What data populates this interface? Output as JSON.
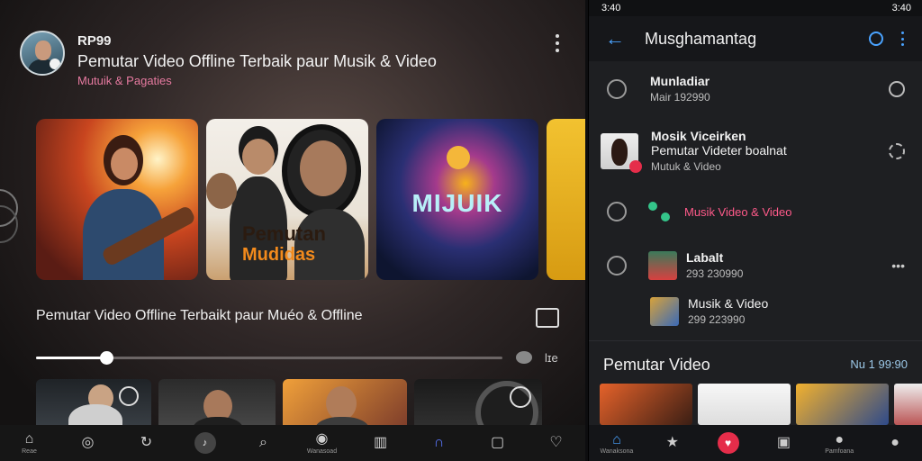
{
  "left": {
    "profile": {
      "username": "RP99",
      "title": "Pemutar Video Offline Terbaik paur Musik & Video",
      "subtitle": "Mutuik & Pagaties"
    },
    "cards": [
      {
        "text": ""
      },
      {
        "text_line1": "Pemutan",
        "text_line2": "Mudidas"
      },
      {
        "text": "MIJUIK"
      },
      {
        "text": ""
      }
    ],
    "now_playing": {
      "title": "Pemutar Video Offline Terbaikt paur Muéo & Offline",
      "progress": 0.15,
      "duration": "lɪe"
    },
    "bottom_nav": [
      {
        "icon": "home-icon",
        "glyph": "⌂",
        "label": "Reae"
      },
      {
        "icon": "headphones-icon",
        "glyph": "◎",
        "label": ""
      },
      {
        "icon": "refresh-icon",
        "glyph": "↻",
        "label": ""
      },
      {
        "icon": "music-icon",
        "glyph": "♪",
        "label": ""
      },
      {
        "icon": "search-icon",
        "glyph": "⌕",
        "label": ""
      },
      {
        "icon": "compass-icon",
        "glyph": "◉",
        "label": "Wanasoad"
      },
      {
        "icon": "library-icon",
        "glyph": "▥",
        "label": ""
      },
      {
        "icon": "headset-icon",
        "glyph": "∩",
        "label": ""
      },
      {
        "icon": "square-icon",
        "glyph": "▢",
        "label": ""
      },
      {
        "icon": "heart-icon",
        "glyph": "♡",
        "label": ""
      }
    ]
  },
  "right": {
    "status_time": "3:40",
    "status_right": "3:40",
    "appbar_title": "Musghamantag",
    "rows": [
      {
        "title": "Munladiar",
        "sub": "Mair 192990"
      },
      {
        "title": "Mosik Viceirken",
        "title2": "Pemutar Videter boalnat",
        "sub": "Mutuk & Video"
      },
      {
        "title": "Musik Video & Video"
      },
      {
        "title": "Labalt",
        "sub": "293 230990"
      },
      {
        "title": "Musik & Video",
        "sub": "299 223990"
      }
    ],
    "section_title": "Pemutar Video",
    "section_right": "Nu 1 99:90",
    "bottom_nav": [
      {
        "icon": "home-icon",
        "glyph": "⌂",
        "label": "Wanaksona"
      },
      {
        "icon": "star-icon",
        "glyph": "★",
        "label": ""
      },
      {
        "icon": "play-icon",
        "glyph": "♥",
        "label": ""
      },
      {
        "icon": "square-icon",
        "glyph": "▣",
        "label": ""
      },
      {
        "icon": "record-icon",
        "glyph": "●",
        "label": "Pamfoana"
      },
      {
        "icon": "person-icon",
        "glyph": "●",
        "label": ""
      }
    ]
  }
}
